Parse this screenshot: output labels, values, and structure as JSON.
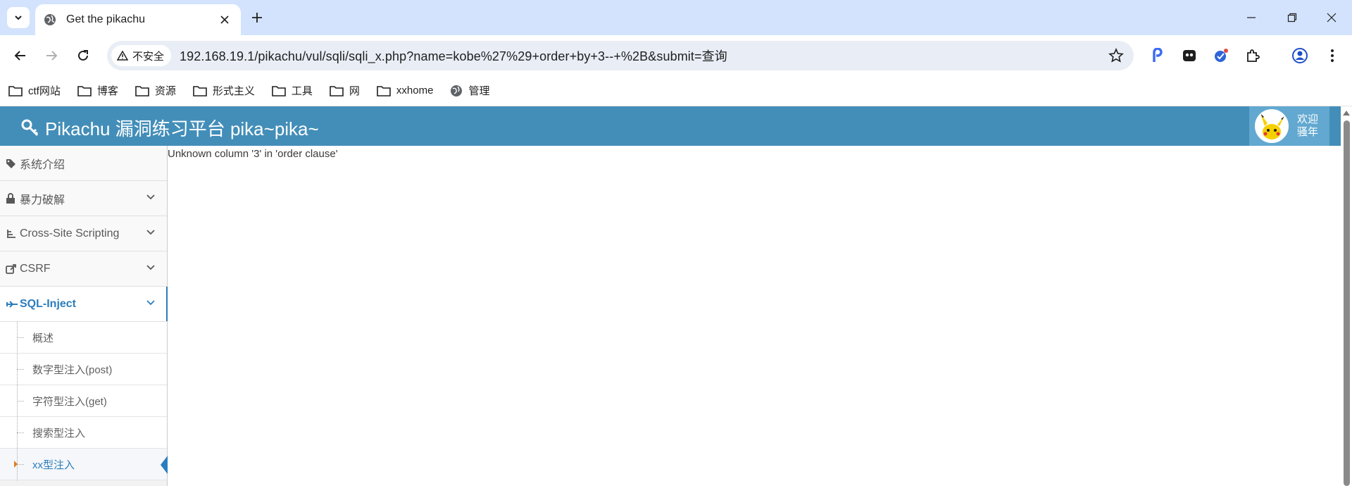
{
  "browser": {
    "tab_title": "Get the pikachu",
    "security_label": "不安全",
    "url": "192.168.19.1/pikachu/vul/sqli/sqli_x.php?name=kobe%27%29+order+by+3--+%2B&submit=查询",
    "bookmarks": [
      "ctf网站",
      "博客",
      "资源",
      "形式主义",
      "工具",
      "网",
      "xxhome",
      "管理"
    ]
  },
  "header": {
    "title": "Pikachu 漏洞练习平台 pika~pika~",
    "welcome_line1": "欢迎",
    "welcome_line2": "骚年"
  },
  "sidebar": {
    "items": [
      {
        "label": "系统介绍",
        "icon": "tags-icon"
      },
      {
        "label": "暴力破解",
        "icon": "lock-icon"
      },
      {
        "label": "Cross-Site Scripting",
        "icon": "sitemap-icon"
      },
      {
        "label": "CSRF",
        "icon": "share-icon"
      },
      {
        "label": "SQL-Inject",
        "icon": "fighter-jet-icon"
      }
    ],
    "subitems": [
      "概述",
      "数字型注入(post)",
      "字符型注入(get)",
      "搜索型注入",
      "xx型注入"
    ]
  },
  "main": {
    "message": "Unknown column '3' in 'order clause'"
  },
  "colors": {
    "navbar": "#438eb9",
    "accent": "#2b7dbc",
    "tabstrip": "#d3e3fd"
  }
}
